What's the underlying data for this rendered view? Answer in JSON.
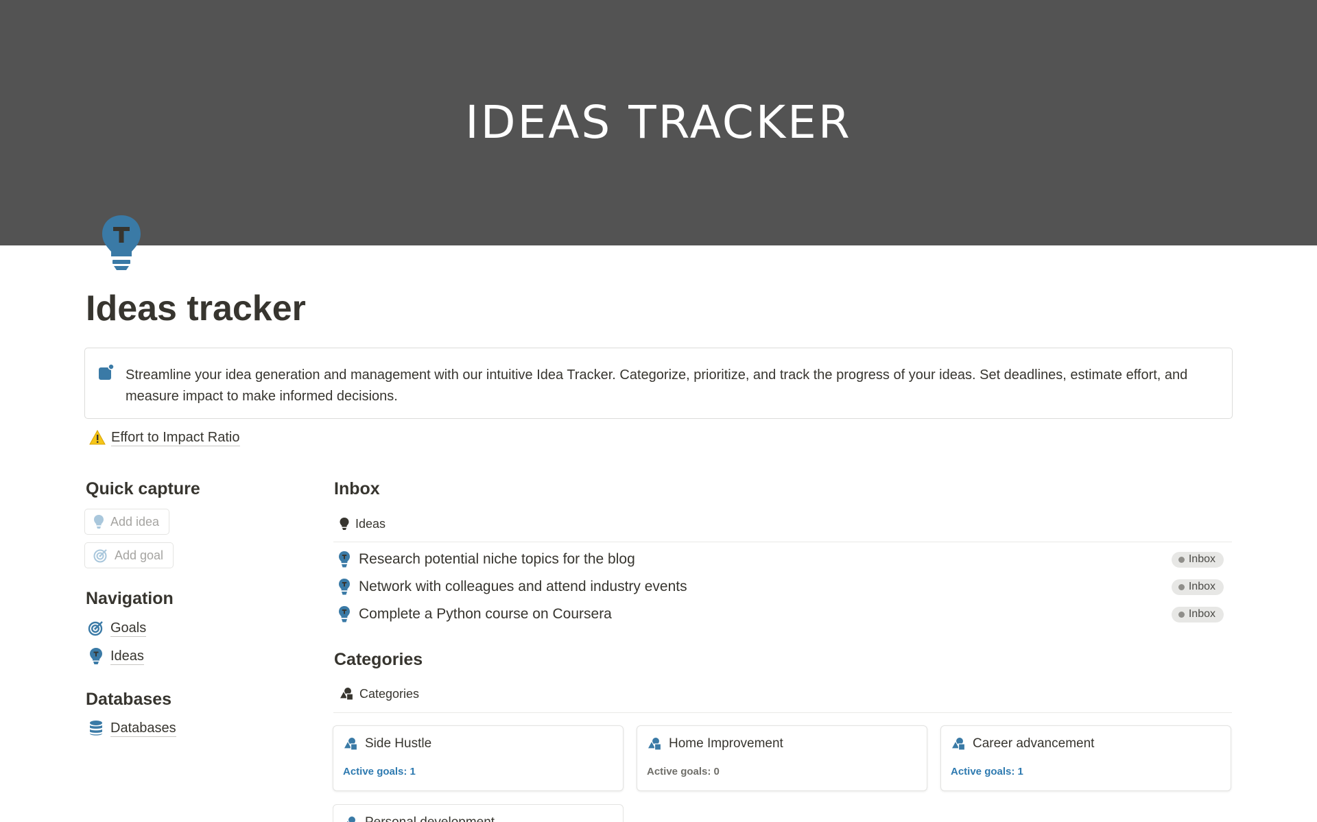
{
  "cover": {
    "title": "IDEAS TRACKER"
  },
  "page": {
    "title": "Ideas tracker"
  },
  "callout": {
    "text": "Streamline your idea generation and management with our intuitive Idea Tracker. Categorize, prioritize, and track the progress of your ideas. Set deadlines, estimate effort, and measure impact to make informed decisions."
  },
  "effort_link": {
    "icon": "warning-icon",
    "label": "Effort to Impact Ratio"
  },
  "quick_capture": {
    "heading": "Quick capture",
    "buttons": [
      {
        "label": "Add idea",
        "icon": "lightbulb-icon"
      },
      {
        "label": "Add goal",
        "icon": "target-icon"
      }
    ]
  },
  "navigation": {
    "heading": "Navigation",
    "items": [
      {
        "label": "Goals",
        "icon": "target-icon"
      },
      {
        "label": "Ideas",
        "icon": "lightbulb-icon"
      }
    ]
  },
  "databases": {
    "heading": "Databases",
    "items": [
      {
        "label": "Databases",
        "icon": "database-icon"
      }
    ]
  },
  "inbox": {
    "heading": "Inbox",
    "view_label": "Ideas",
    "rows": [
      {
        "title": "Research potential niche topics for the blog",
        "status": "Inbox"
      },
      {
        "title": "Network with colleagues and attend industry events",
        "status": "Inbox"
      },
      {
        "title": "Complete a Python course on Coursera",
        "status": "Inbox"
      }
    ]
  },
  "categories": {
    "heading": "Categories",
    "view_label": "Categories",
    "cards": [
      {
        "name": "Side Hustle",
        "goals": "Active goals: 1",
        "goals_color": "#2e7ab0"
      },
      {
        "name": "Home Improvement",
        "goals": "Active goals: 0",
        "goals_color": "#6f6e69"
      },
      {
        "name": "Career advancement",
        "goals": "Active goals: 1",
        "goals_color": "#2e7ab0"
      },
      {
        "name": "Personal development"
      }
    ]
  },
  "colors": {
    "accent": "#3a7aa6",
    "cover": "#535353",
    "text": "#37352f"
  }
}
